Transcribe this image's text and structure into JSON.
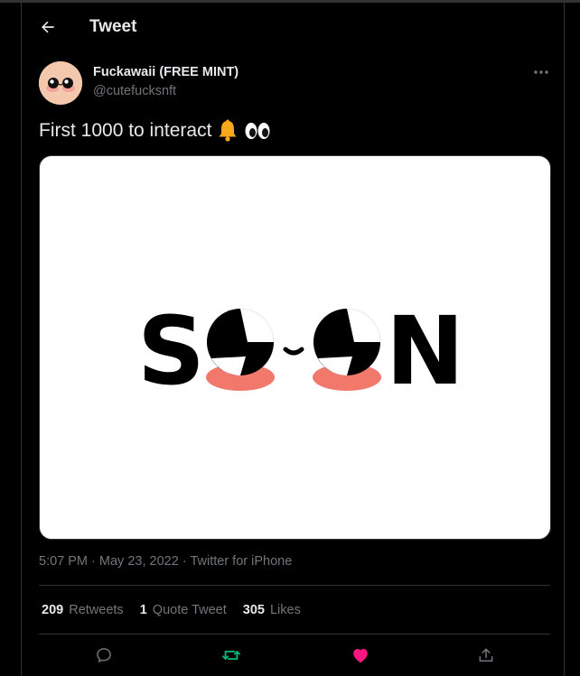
{
  "header": {
    "title": "Tweet",
    "back_icon": "arrow-left-icon"
  },
  "tweet": {
    "author": {
      "name": "Fuckawaii (FREE MINT)",
      "handle": "@cutefucksnft"
    },
    "text": "First 1000 to interact",
    "emojis": [
      "bell-icon",
      "eyes-icon"
    ],
    "media_text": "SOON",
    "time": "5:07 PM",
    "date": "May 23, 2022",
    "source": "Twitter for iPhone",
    "separator": "·"
  },
  "stats": {
    "retweets": {
      "count": "209",
      "label": "Retweets"
    },
    "quotes": {
      "count": "1",
      "label": "Quote Tweet"
    },
    "likes": {
      "count": "305",
      "label": "Likes"
    }
  },
  "actions": [
    "reply-icon",
    "retweet-icon",
    "like-icon",
    "share-icon"
  ],
  "colors": {
    "background": "#000000",
    "text": "#e7e9ea",
    "muted": "#71767b",
    "divider": "#2f3336",
    "retweet_active": "#00ba7c",
    "like_active": "#f91880",
    "blush": "#f2786c"
  }
}
